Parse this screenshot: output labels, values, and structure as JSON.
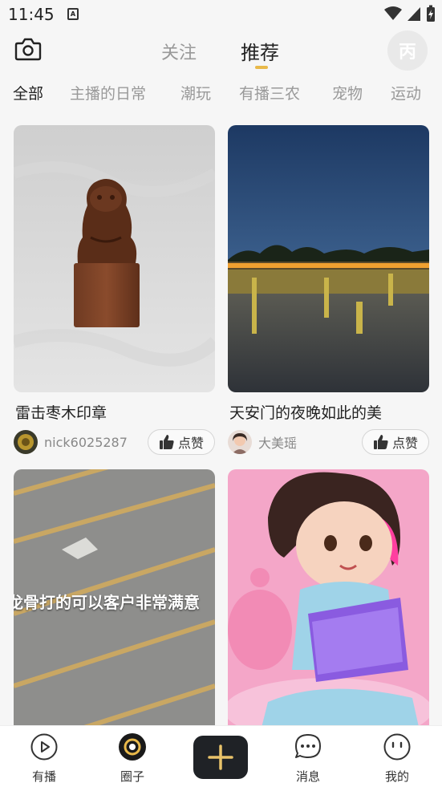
{
  "status_bar": {
    "time": "11:45",
    "notif_glyph": "A"
  },
  "header": {
    "tabs": [
      {
        "label": "关注"
      },
      {
        "label": "推荐"
      }
    ],
    "active_tab": "推荐",
    "accent_color": "#e9b94a",
    "avatar_glyph": "丙"
  },
  "categories": [
    {
      "label": "全部"
    },
    {
      "label": "主播的日常"
    },
    {
      "label": "潮玩"
    },
    {
      "label": "有播三农"
    },
    {
      "label": "宠物"
    },
    {
      "label": "运动"
    }
  ],
  "feed": {
    "cards": [
      {
        "title": "雷击枣木印章",
        "author": "nick6025287",
        "like_label": "点赞"
      },
      {
        "title": "天安门的夜晚如此的美",
        "author": "大美瑶",
        "like_label": "点赞"
      },
      {
        "overlay_text": "龙骨打的可以客户非常满意"
      },
      {}
    ]
  },
  "bottom_nav": {
    "items": [
      {
        "label": "有播",
        "icon": "play-circle-icon"
      },
      {
        "label": "圈子",
        "icon": "circle-ring-icon"
      },
      {
        "label": "",
        "icon": "plus-icon"
      },
      {
        "label": "消息",
        "icon": "chat-bubble-icon"
      },
      {
        "label": "我的",
        "icon": "face-icon"
      }
    ]
  }
}
